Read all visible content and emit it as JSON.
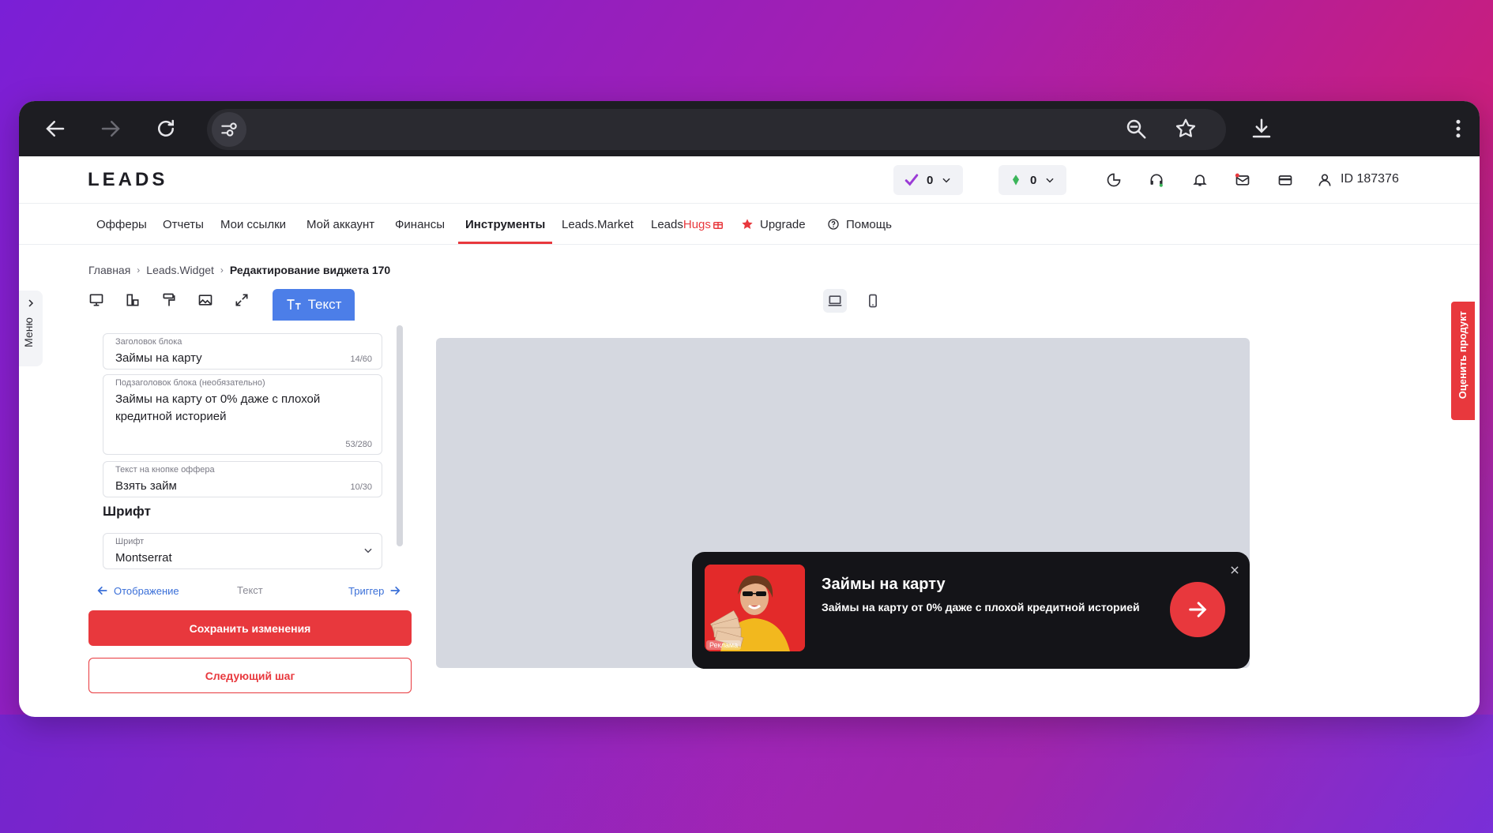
{
  "site": {
    "logo": "LEADS",
    "counters": [
      {
        "value": "0",
        "icon": "purple-check-icon"
      },
      {
        "value": "0",
        "icon": "green-crystal-icon"
      }
    ],
    "user_id": "ID 187376"
  },
  "nav": {
    "items": [
      "Офферы",
      "Отчеты",
      "Мои ссылки",
      "Мой аккаунт",
      "Финансы",
      "Инструменты",
      "Leads.Market"
    ],
    "hugs_prefix": "Leads",
    "hugs_suffix": "Hugs",
    "upgrade": "Upgrade",
    "help": "Помощь",
    "active": "Инструменты"
  },
  "breadcrumb": {
    "home": "Главная",
    "section": "Leads.Widget",
    "current": "Редактирование виджета 170"
  },
  "side_menu": {
    "label": "Меню"
  },
  "editor": {
    "active_tab": "Текст",
    "fields": {
      "title": {
        "label": "Заголовок блока",
        "value": "Займы на карту",
        "count": "14/60"
      },
      "subtitle": {
        "label": "Подзаголовок блока (необязательно)",
        "value": "Займы на карту от 0% даже с плохой кредитной историей",
        "count": "53/280"
      },
      "button": {
        "label": "Текст на кнопке оффера",
        "value": "Взять займ",
        "count": "10/30"
      }
    },
    "font_heading": "Шрифт",
    "font_select": {
      "label": "Шрифт",
      "value": "Montserrat"
    },
    "steps": {
      "prev": "Отображение",
      "current": "Текст",
      "next": "Триггер"
    },
    "save_button": "Сохранить изменения",
    "next_button": "Следующий шаг"
  },
  "widget": {
    "title": "Займы на карту",
    "subtitle": "Займы на карту от 0% даже с плохой кредитной историей",
    "ad_badge": "Реклама"
  },
  "rate_tab": {
    "label": "Оценить продукт"
  },
  "colors": {
    "accent_red": "#e8383d",
    "accent_blue": "#4c7ee8",
    "widget_bg": "#141418",
    "preview_bg": "#d5d8e0"
  }
}
